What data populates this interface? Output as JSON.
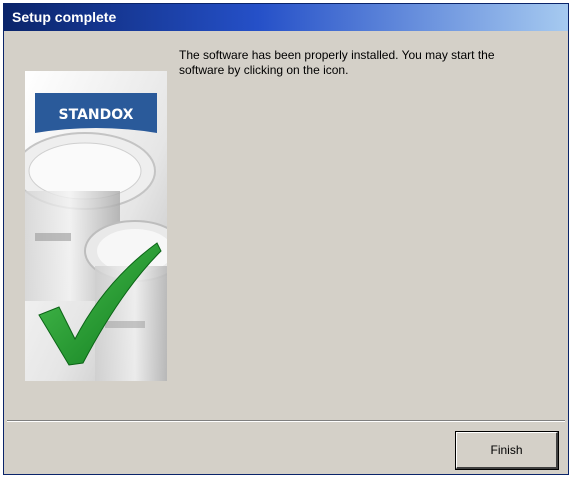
{
  "window": {
    "title": "Setup complete"
  },
  "message": "The software has been properly installed. You may start the software by clicking on the icon.",
  "branding": {
    "logo_text": "STANDOX",
    "logo_color": "#2a5a9a",
    "checkmark_color": "#1f9a2a"
  },
  "buttons": {
    "finish_label": "Finish"
  },
  "colors": {
    "title_gradient_start": "#0a246a",
    "title_gradient_end": "#a6caf0",
    "window_face": "#d4d0c8"
  }
}
